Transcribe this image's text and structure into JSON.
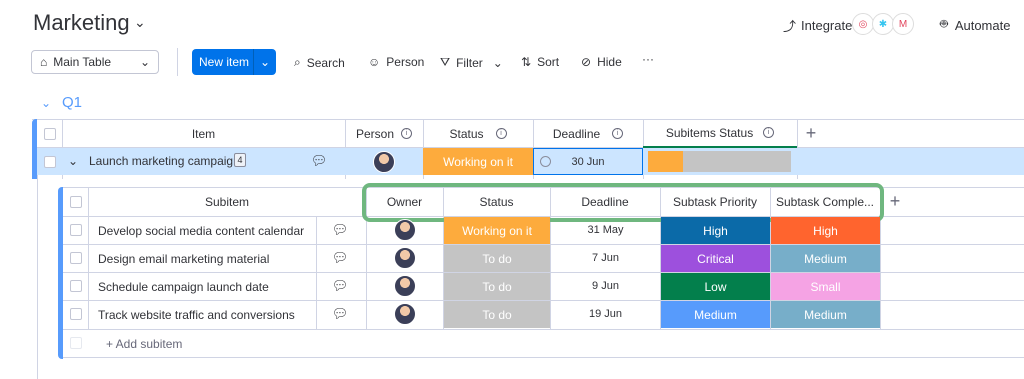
{
  "board": {
    "title": "Marketing",
    "title_chevron": "⌄"
  },
  "topbar": {
    "integrate_label": "Integrate",
    "automate_label": "Automate",
    "integration_icons": [
      "gear-icon",
      "slack-icon",
      "gmail-icon"
    ]
  },
  "toolbar": {
    "view_label": "Main Table",
    "new_item_label": "New item",
    "search_label": "Search",
    "person_label": "Person",
    "filter_label": "Filter",
    "sort_label": "Sort",
    "hide_label": "Hide",
    "more_label": "···"
  },
  "group": {
    "title": "Q1",
    "color": "#579bfc",
    "columns": {
      "item": "Item",
      "person": "Person",
      "status": "Status",
      "deadline": "Deadline",
      "subitems_status": "Subitems Status"
    },
    "item": {
      "name": "Launch marketing campaign",
      "subitem_count": "4",
      "status": "Working on it",
      "status_color": "#fdab3d",
      "deadline": "30 Jun"
    }
  },
  "subitems": {
    "columns": {
      "subitem": "Subitem",
      "owner": "Owner",
      "status": "Status",
      "deadline": "Deadline",
      "priority": "Subtask Priority",
      "complexity": "Subtask Comple..."
    },
    "rows": [
      {
        "name": "Develop social media content calendar",
        "status": "Working on it",
        "status_color": "#fdab3d",
        "deadline": "31 May",
        "priority": "High",
        "priority_color": "#0b6aa8",
        "complexity": "High",
        "complexity_color": "#ff642e"
      },
      {
        "name": "Design email marketing material",
        "status": "To do",
        "status_color": "#c4c4c4",
        "deadline": "7 Jun",
        "priority": "Critical",
        "priority_color": "#9d50dd",
        "complexity": "Medium",
        "complexity_color": "#77aec9"
      },
      {
        "name": "Schedule campaign launch date",
        "status": "To do",
        "status_color": "#c4c4c4",
        "deadline": "9 Jun",
        "priority": "Low",
        "priority_color": "#037f4c",
        "complexity": "Small",
        "complexity_color": "#f5a3e4"
      },
      {
        "name": "Track website traffic and conversions",
        "status": "To do",
        "status_color": "#c4c4c4",
        "deadline": "19 Jun",
        "priority": "Medium",
        "priority_color": "#579bfc",
        "complexity": "Medium",
        "complexity_color": "#77aec9"
      }
    ],
    "add_label": "+ Add subitem"
  }
}
